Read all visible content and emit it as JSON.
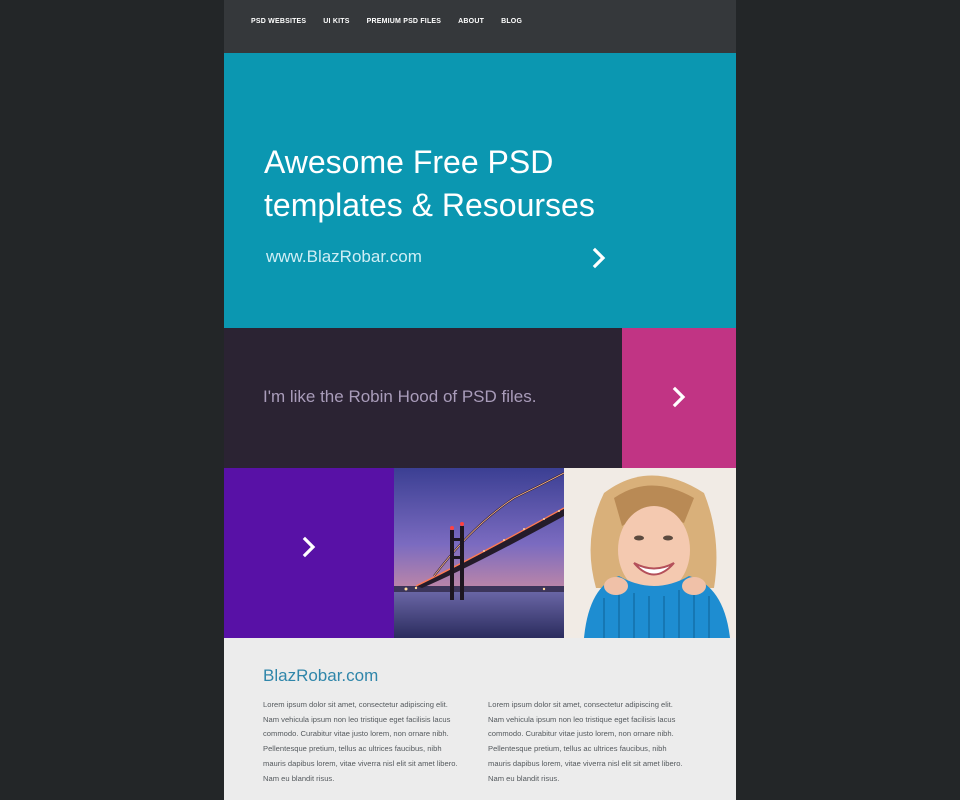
{
  "nav": {
    "links": [
      "PSD WEBSITES",
      "UI KITS",
      "PREMIUM PSD FILES",
      "ABOUT",
      "BLOG"
    ]
  },
  "hero": {
    "title": "Awesome Free PSD templates & Resourses",
    "url": "www.BlazRobar.com",
    "background": "#0b97b1"
  },
  "band": {
    "text": "I'm like the Robin Hood of PSD files.",
    "background": "#2b2333",
    "accent": "#c13484"
  },
  "tiles": {
    "purple": "#5811a6",
    "images": [
      "bridge-at-night-photo",
      "smiling-woman-photo"
    ]
  },
  "content": {
    "heading": "BlazRobar.com",
    "columns": [
      "Lorem ipsum dolor sit amet, consectetur adipiscing elit. Nam vehicula ipsum non leo tristique eget facilisis lacus commodo. Curabitur vitae justo lorem, non ornare nibh. Pellentesque pretium, tellus ac ultrices faucibus, nibh mauris dapibus lorem, vitae viverra nisl elit sit amet libero. Nam eu blandit risus.",
      "Lorem ipsum dolor sit amet, consectetur adipiscing elit. Nam vehicula ipsum non leo tristique eget facilisis lacus commodo. Curabitur vitae justo lorem, non ornare nibh. Pellentesque pretium, tellus ac ultrices faucibus, nibh mauris dapibus lorem, vitae viverra nisl elit sit amet libero. Nam eu blandit risus."
    ]
  },
  "icons": [
    "chevron-right-icon"
  ]
}
